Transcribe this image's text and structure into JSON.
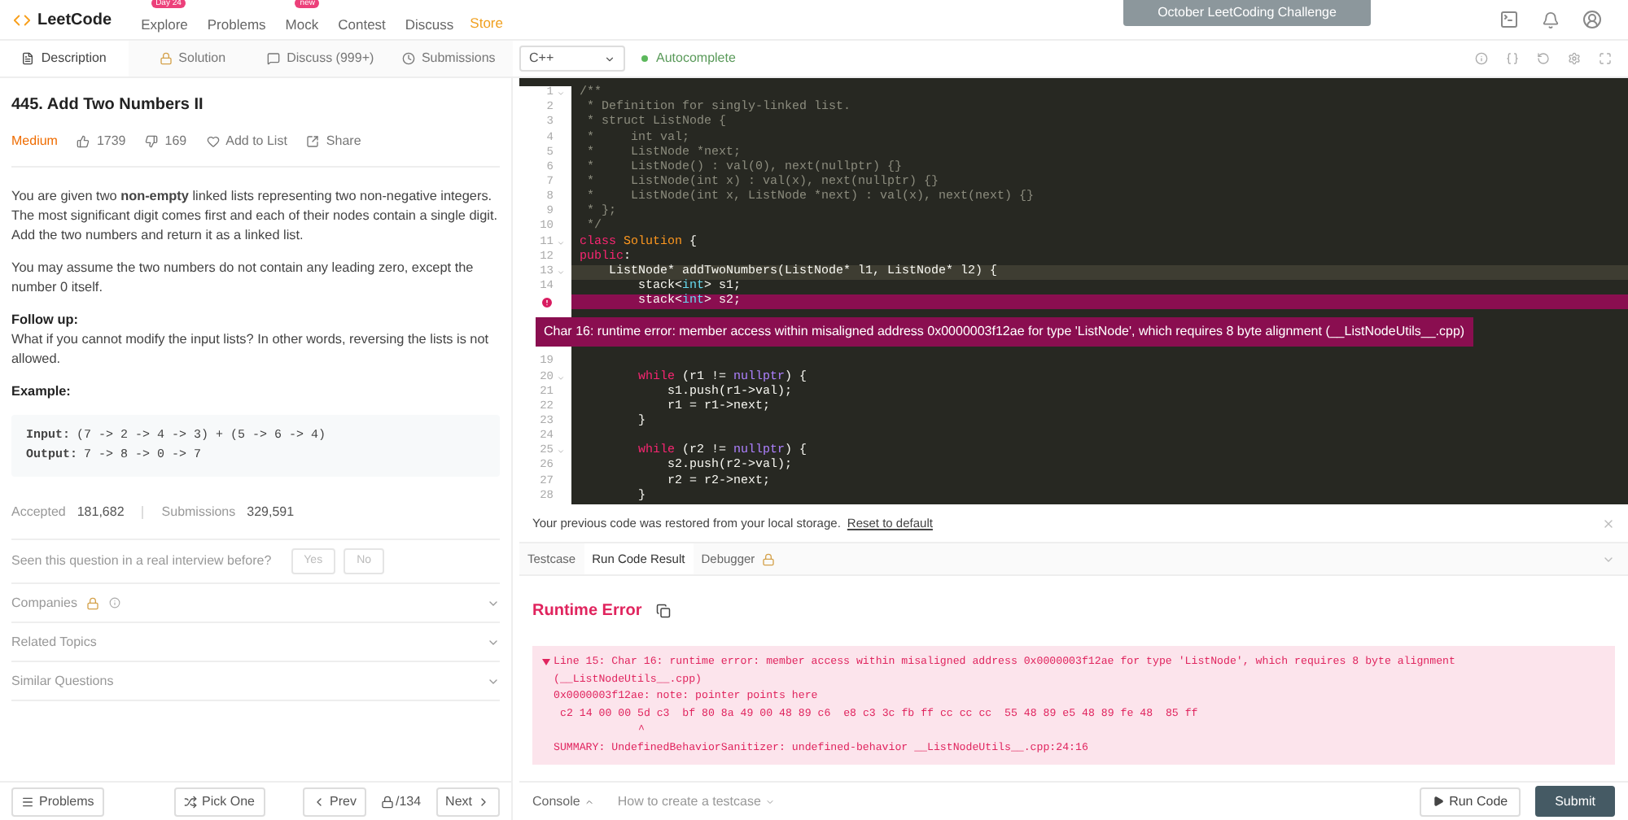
{
  "nav": {
    "logo": "LeetCode",
    "links": [
      {
        "label": "Explore",
        "badge": "Day 24"
      },
      {
        "label": "Problems"
      },
      {
        "label": "Mock",
        "badge": "new"
      },
      {
        "label": "Contest"
      },
      {
        "label": "Discuss"
      }
    ],
    "store": "Store",
    "banner": "October LeetCoding Challenge"
  },
  "left_tabs": [
    {
      "label": "Description",
      "selected": true,
      "kind": "description"
    },
    {
      "label": "Solution",
      "selected": false,
      "kind": "solution"
    },
    {
      "label": "Discuss (999+)",
      "selected": false,
      "kind": "discuss"
    },
    {
      "label": "Submissions",
      "selected": false,
      "kind": "submissions"
    }
  ],
  "problem": {
    "title": "445. Add Two Numbers II",
    "difficulty": "Medium",
    "likes": "1739",
    "dislikes": "169",
    "add_to_list": "Add to List",
    "share": "Share",
    "paragraphs": [
      "You are given two **non-empty** linked lists representing two non-negative integers. The most significant digit comes first and each of their nodes contain a single digit. Add the two numbers and return it as a linked list.",
      "You may assume the two numbers do not contain any leading zero, except the number 0 itself."
    ],
    "follow_up_heading": "Follow up:",
    "follow_up": "What if you cannot modify the input lists? In other words, reversing the lists is not allowed.",
    "example_heading": "Example:",
    "example": [
      {
        "label": "Input:",
        "value": "(7 -> 2 -> 4 -> 3) + (5 -> 6 -> 4)"
      },
      {
        "label": "Output:",
        "value": "7 -> 8 -> 0 -> 7"
      }
    ],
    "accepted_label": "Accepted",
    "accepted": "181,682",
    "submissions_label": "Submissions",
    "submissions": "329,591",
    "interview_question": "Seen this question in a real interview before?",
    "interview_buttons": [
      "Yes",
      "No"
    ],
    "sections": [
      {
        "label": "Companies",
        "premium": true,
        "expanded": false
      },
      {
        "label": "Related Topics",
        "premium": false,
        "expanded": false
      },
      {
        "label": "Similar Questions",
        "premium": false,
        "expanded": false
      }
    ]
  },
  "footer": {
    "problems": "Problems",
    "pick_one": "Pick One",
    "prev": "Prev",
    "counter": "/134",
    "next": "Next"
  },
  "editor": {
    "language": "C++",
    "autocomplete": {
      "label": "Autocomplete",
      "on": true
    },
    "lines": [
      {
        "n": "1",
        "fold": true,
        "highlighted": false,
        "error": false,
        "tokens": [
          {
            "kind": "comment",
            "t": "/**"
          }
        ]
      },
      {
        "n": "2",
        "fold": false,
        "highlighted": false,
        "error": false,
        "tokens": [
          {
            "kind": "comment",
            "t": " * Definition for singly-linked list."
          }
        ]
      },
      {
        "n": "3",
        "fold": false,
        "highlighted": false,
        "error": false,
        "tokens": [
          {
            "kind": "comment",
            "t": " * struct ListNode {"
          }
        ]
      },
      {
        "n": "4",
        "fold": false,
        "highlighted": false,
        "error": false,
        "tokens": [
          {
            "kind": "comment",
            "t": " *     int val;"
          }
        ]
      },
      {
        "n": "5",
        "fold": false,
        "highlighted": false,
        "error": false,
        "tokens": [
          {
            "kind": "comment",
            "t": " *     ListNode *next;"
          }
        ]
      },
      {
        "n": "6",
        "fold": false,
        "highlighted": false,
        "error": false,
        "tokens": [
          {
            "kind": "comment",
            "t": " *     ListNode() : val(0), next(nullptr) {}"
          }
        ]
      },
      {
        "n": "7",
        "fold": false,
        "highlighted": false,
        "error": false,
        "tokens": [
          {
            "kind": "comment",
            "t": " *     ListNode(int x) : val(x), next(nullptr) {}"
          }
        ]
      },
      {
        "n": "8",
        "fold": false,
        "highlighted": false,
        "error": false,
        "tokens": [
          {
            "kind": "comment",
            "t": " *     ListNode(int x, ListNode *next) : val(x), next(next) {}"
          }
        ]
      },
      {
        "n": "9",
        "fold": false,
        "highlighted": false,
        "error": false,
        "tokens": [
          {
            "kind": "comment",
            "t": " * };"
          }
        ]
      },
      {
        "n": "10",
        "fold": false,
        "highlighted": false,
        "error": false,
        "tokens": [
          {
            "kind": "comment",
            "t": " */"
          }
        ]
      },
      {
        "n": "11",
        "fold": true,
        "highlighted": false,
        "error": false,
        "tokens": [
          {
            "kind": "keyword",
            "t": "class"
          },
          {
            "kind": "class",
            "t": " Solution"
          },
          {
            "kind": "text",
            "t": " {"
          }
        ]
      },
      {
        "n": "12",
        "fold": false,
        "highlighted": false,
        "error": false,
        "tokens": [
          {
            "kind": "keyword",
            "t": "public"
          },
          {
            "kind": "text",
            "t": ":"
          }
        ]
      },
      {
        "n": "13",
        "fold": true,
        "highlighted": true,
        "error": false,
        "tokens": [
          {
            "kind": "text",
            "t": "    ListNode* addTwoNumbers(ListNode* l1, ListNode* l2) {"
          }
        ]
      },
      {
        "n": "14",
        "fold": false,
        "highlighted": false,
        "error": false,
        "tokens": [
          {
            "kind": "text",
            "t": "        stack<"
          },
          {
            "kind": "type",
            "t": "int"
          },
          {
            "kind": "text",
            "t": "> s1;"
          }
        ]
      },
      {
        "fold": false,
        "highlighted": false,
        "error": true,
        "tokens": [
          {
            "kind": "text",
            "t": "        stack<"
          },
          {
            "kind": "type",
            "t": "int"
          },
          {
            "kind": "text",
            "t": "> s2;"
          }
        ]
      },
      {
        "n": "19",
        "fold": false,
        "highlighted": false,
        "error": false
      },
      {
        "n": "20",
        "fold": true,
        "highlighted": false,
        "error": false,
        "tokens": [
          {
            "kind": "keyword",
            "t": "        while"
          },
          {
            "kind": "text",
            "t": " (r1 != "
          },
          {
            "kind": "constant",
            "t": "nullptr"
          },
          {
            "kind": "text",
            "t": ") {"
          }
        ]
      },
      {
        "n": "21",
        "fold": false,
        "highlighted": false,
        "error": false,
        "tokens": [
          {
            "kind": "text",
            "t": "            s1.push(r1->val);"
          }
        ]
      },
      {
        "n": "22",
        "fold": false,
        "highlighted": false,
        "error": false,
        "tokens": [
          {
            "kind": "text",
            "t": "            r1 = r1->next;"
          }
        ]
      },
      {
        "n": "23",
        "fold": false,
        "highlighted": false,
        "error": false,
        "tokens": [
          {
            "kind": "text",
            "t": "        }"
          }
        ]
      },
      {
        "n": "24",
        "fold": false,
        "highlighted": false,
        "error": false
      },
      {
        "n": "25",
        "fold": true,
        "highlighted": false,
        "error": false,
        "tokens": [
          {
            "kind": "keyword",
            "t": "        while"
          },
          {
            "kind": "text",
            "t": " (r2 != "
          },
          {
            "kind": "constant",
            "t": "nullptr"
          },
          {
            "kind": "text",
            "t": ") {"
          }
        ]
      },
      {
        "n": "26",
        "fold": false,
        "highlighted": false,
        "error": false,
        "tokens": [
          {
            "kind": "text",
            "t": "            s2.push(r2->val);"
          }
        ]
      },
      {
        "n": "27",
        "fold": false,
        "highlighted": false,
        "error": false,
        "tokens": [
          {
            "kind": "text",
            "t": "            r2 = r2->next;"
          }
        ]
      },
      {
        "n": "28",
        "fold": false,
        "highlighted": false,
        "error": false,
        "tokens": [
          {
            "kind": "text",
            "t": "        }"
          }
        ]
      }
    ],
    "tooltip": "Char 16: runtime error: member access within misaligned address 0x0000003f12ae for type 'ListNode', which requires 8 byte alignment (__ListNodeUtils__.cpp)"
  },
  "notice": {
    "text": "Your previous code was restored from your local storage.",
    "link": "Reset to default"
  },
  "result_tabs": [
    {
      "label": "Testcase",
      "selected": false,
      "locked": false
    },
    {
      "label": "Run Code Result",
      "selected": true,
      "locked": false
    },
    {
      "label": "Debugger",
      "selected": false,
      "locked": true
    }
  ],
  "result": {
    "title": "Runtime Error",
    "expanded": true,
    "lines": [
      "Line 15: Char 16: runtime error: member access within misaligned address 0x0000003f12ae for type 'ListNode', which requires 8 byte alignment",
      "(__ListNodeUtils__.cpp)",
      "0x0000003f12ae: note: pointer points here",
      "c2 14 00 00 5d c3  bf 80 8a 49 00 48 89 c6  e8 c3 3c fb ff cc cc cc  55 48 89 e5 48 89 fe 48  85 ff",
      "^",
      "SUMMARY: UndefinedBehaviorSanitizer: undefined-behavior __ListNodeUtils__.cpp:24:16"
    ]
  },
  "bottom": {
    "console": "Console",
    "howto": "How to create a testcase",
    "run": "Run Code",
    "submit": "Submit"
  }
}
